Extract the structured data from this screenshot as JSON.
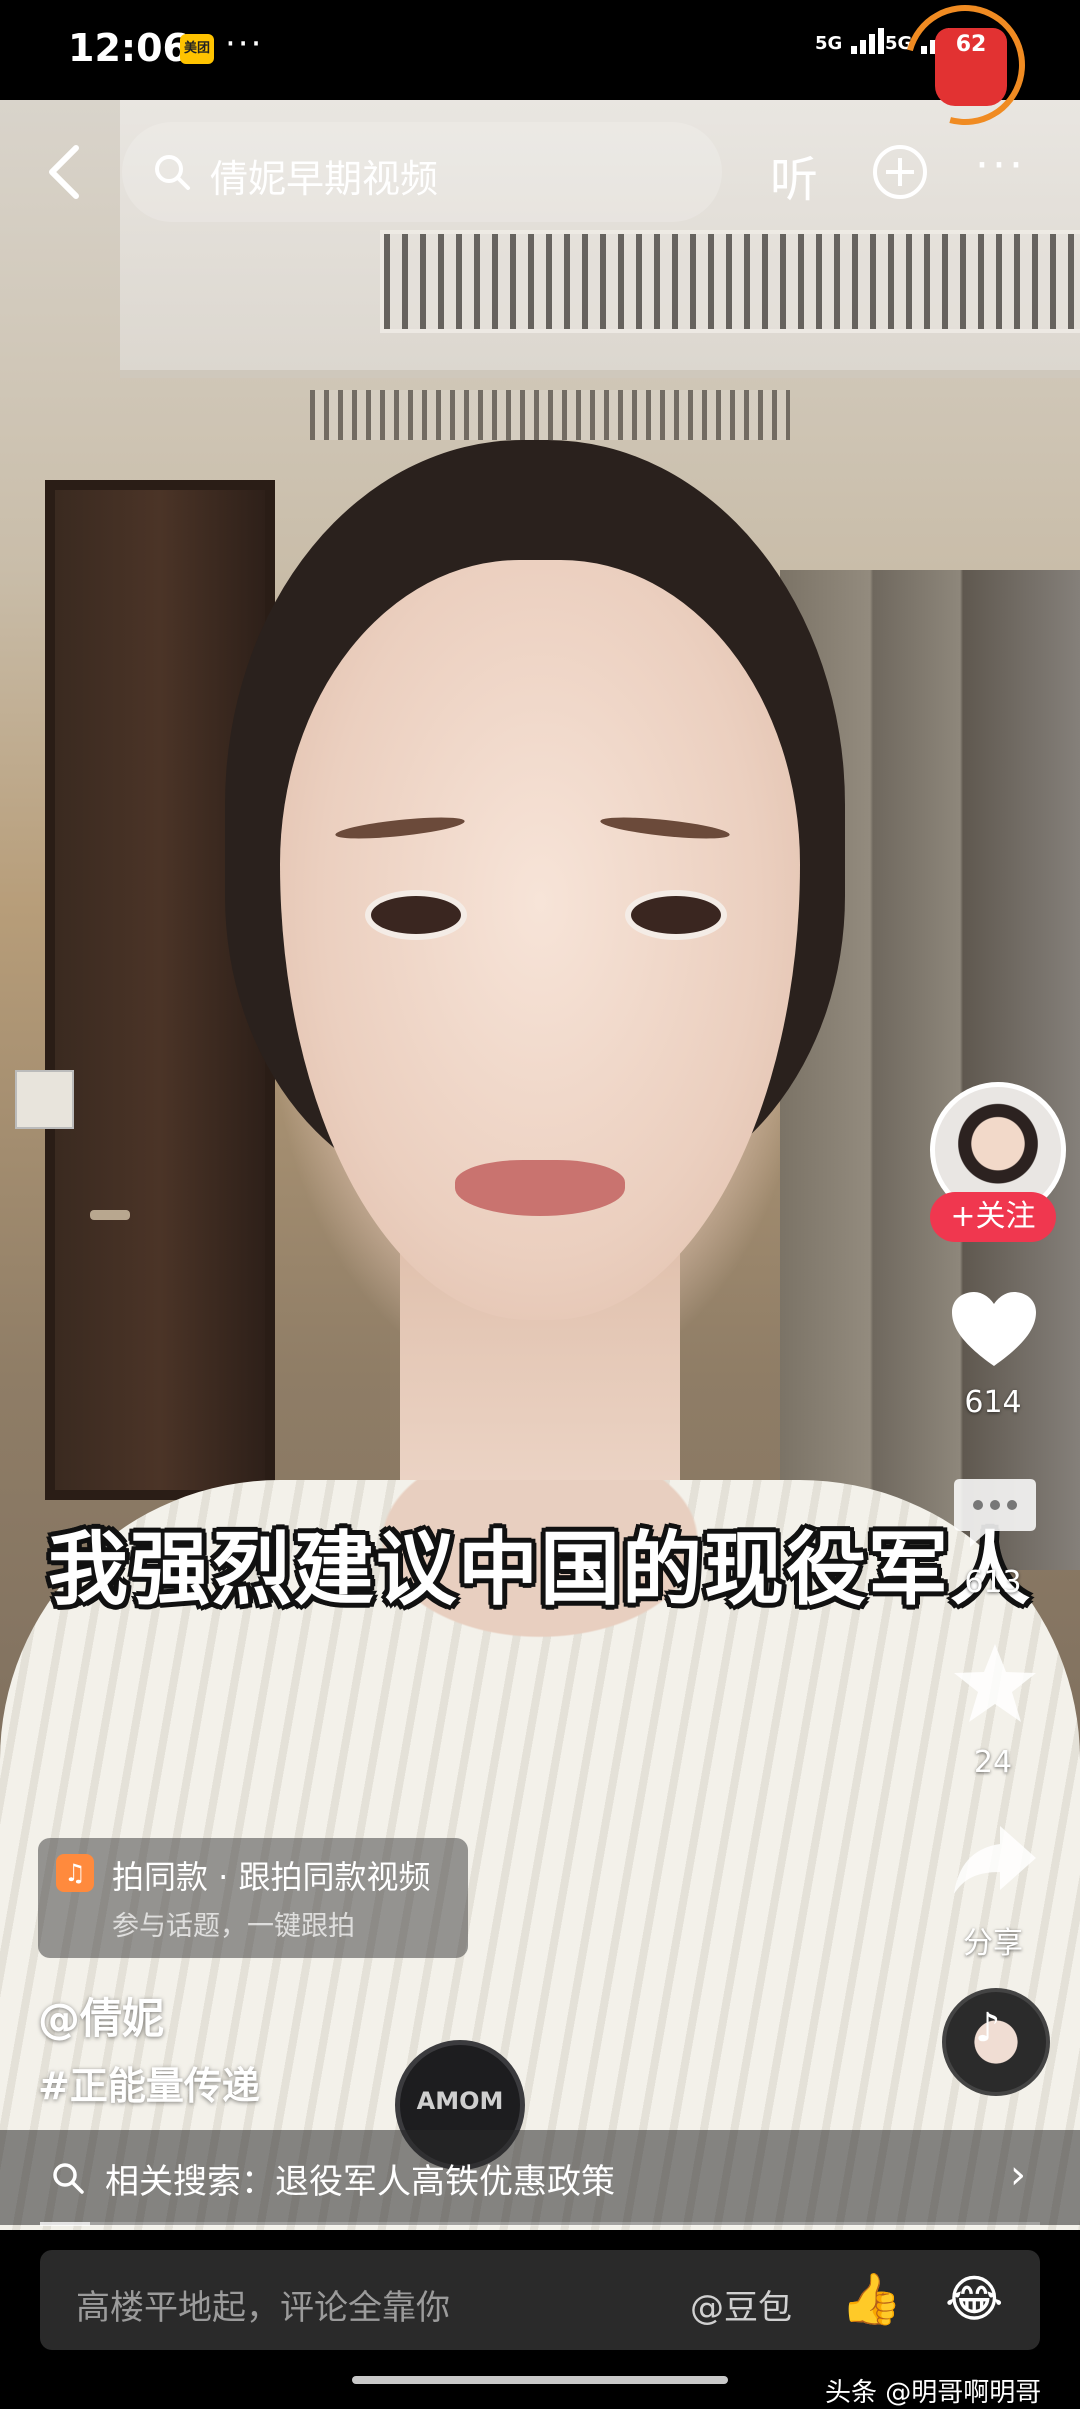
{
  "status_bar": {
    "time": "12:06",
    "app_badge": "美团",
    "more_dots": "···",
    "signal1": "5G",
    "signal2": "5G",
    "battery": "62"
  },
  "top_bar": {
    "search_text": "倩妮早期视频",
    "listen_label": "听",
    "more_label": "···"
  },
  "video": {
    "caption": "我强烈建议中国的现役军人",
    "mic_text": "AMOM"
  },
  "actions": {
    "follow_label": "+关注",
    "like_count": "614",
    "comment_count": "613",
    "star_count": "24",
    "share_label": "分享"
  },
  "same_style": {
    "title": "拍同款 · 跟拍同款视频",
    "subtitle": "参与话题，一键跟拍"
  },
  "post": {
    "author": "@倩妮",
    "hashtag": "#正能量传递"
  },
  "related_search": {
    "text": "相关搜索：退役军人高铁优惠政策"
  },
  "comment_bar": {
    "placeholder": "高楼平地起，评论全靠你",
    "mention": "@豆包"
  },
  "watermark": "头条 @明哥啊明哥",
  "progress": 0.05,
  "colors": {
    "follow": "#f0374f",
    "battery": "#e23232",
    "battery_ring": "#f08b22"
  }
}
